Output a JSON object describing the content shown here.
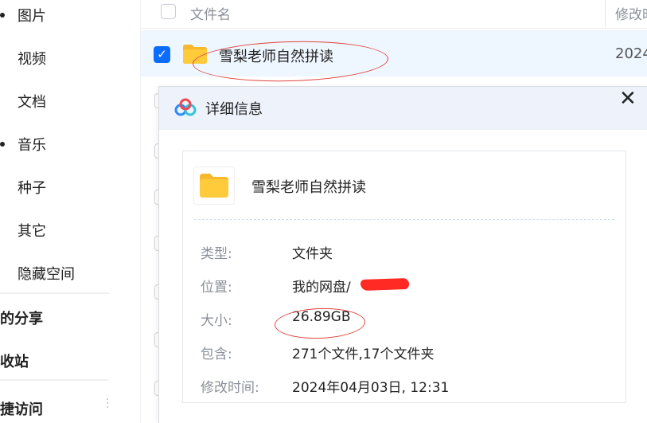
{
  "sidebar": {
    "items": [
      {
        "label": "图片"
      },
      {
        "label": "视频"
      },
      {
        "label": "文档"
      },
      {
        "label": "音乐"
      },
      {
        "label": "种子"
      },
      {
        "label": "其它"
      },
      {
        "label": "隐藏空间"
      }
    ],
    "sections": [
      {
        "label": "的分享"
      },
      {
        "label": "收站"
      },
      {
        "label": "捷访问"
      }
    ]
  },
  "list": {
    "header": {
      "name": "文件名",
      "modified": "修改时"
    },
    "selected_row": {
      "name": "雪梨老师自然拼读",
      "date": "2024"
    }
  },
  "dialog": {
    "title": "详细信息",
    "close": "✕",
    "name": "雪梨老师自然拼读",
    "rows": [
      {
        "label": "类型:",
        "value": "文件夹"
      },
      {
        "label": "位置:",
        "value": "我的网盘/"
      },
      {
        "label": "大小:",
        "value": "26.89GB"
      },
      {
        "label": "包含:",
        "value": "271个文件,17个文件夹"
      },
      {
        "label": "修改时间:",
        "value": "2024年04月03日, 12:31"
      }
    ]
  },
  "colors": {
    "accent": "#0a6dff",
    "selected_row_bg": "#eef6ff",
    "dialog_header_bg": "#eef3fb",
    "annotation_red": "#e0443a",
    "folder_yellow": "#ffcb3a"
  },
  "icons": {
    "checkbox": "checkbox-icon",
    "checked": "checkmark-icon",
    "folder": "folder-icon",
    "logo": "cloud-logo-icon",
    "close": "close-icon",
    "more": "more-vertical-icon"
  }
}
